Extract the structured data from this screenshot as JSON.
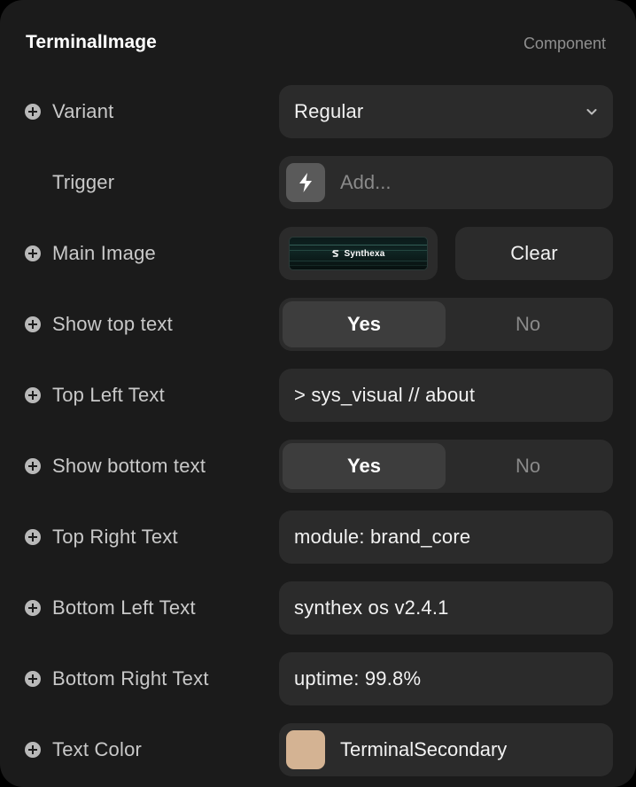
{
  "panel": {
    "title": "TerminalImage",
    "subtitle": "Component"
  },
  "variant": {
    "label": "Variant",
    "value": "Regular",
    "icon": "chevron-down-icon"
  },
  "trigger": {
    "label": "Trigger",
    "placeholder": "Add...",
    "icon": "lightning-icon"
  },
  "main_image": {
    "label": "Main Image",
    "thumbnail_text": "Synthexa",
    "clear_label": "Clear"
  },
  "show_top_text": {
    "label": "Show top text",
    "yes": "Yes",
    "no": "No",
    "selected": "Yes"
  },
  "top_left_text": {
    "label": "Top Left Text",
    "value": "> sys_visual // about"
  },
  "show_bottom_text": {
    "label": "Show bottom text",
    "yes": "Yes",
    "no": "No",
    "selected": "Yes"
  },
  "top_right_text": {
    "label": "Top Right Text",
    "value": "module: brand_core"
  },
  "bottom_left_text": {
    "label": "Bottom Left Text",
    "value": "synthex os v2.4.1"
  },
  "bottom_right_text": {
    "label": "Bottom Right Text",
    "value": "uptime: 99.8%"
  },
  "text_color": {
    "label": "Text Color",
    "value": "TerminalSecondary",
    "swatch": "#d4b393"
  },
  "colors": {
    "panel_bg": "#1b1b1b",
    "control_bg": "#2b2b2b",
    "selected_bg": "#3d3d3d"
  }
}
